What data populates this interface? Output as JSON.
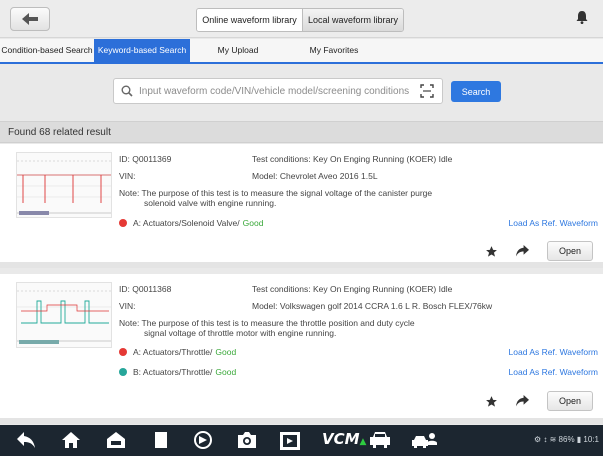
{
  "header": {
    "tabs": [
      "Online waveform library",
      "Local waveform library"
    ]
  },
  "tabs": [
    "Condition-based Search",
    "Keyword-based Search",
    "My Upload",
    "My Favorites"
  ],
  "search": {
    "placeholder": "Input waveform code/VIN/vehicle model/screening conditions",
    "button": "Search"
  },
  "results": {
    "summary": "Found 68 related result",
    "items": [
      {
        "id": "ID: Q0011369",
        "test_conditions": "Test conditions: Key On Enging Running (KOER) Idle",
        "vin": "VIN:",
        "model": "Model: Chevrolet Aveo 2016 1.5L",
        "note_line1": "Note: The purpose of this test is to measure the signal voltage of the canister purge",
        "note_line2": "solenoid valve with engine running.",
        "channels": [
          {
            "label": "A: Actuators/Solenoid Valve/",
            "status": "Good",
            "color": "#e53935",
            "action": "Load As Ref. Waveform"
          }
        ],
        "open": "Open"
      },
      {
        "id": "ID: Q0011368",
        "test_conditions": "Test conditions: Key On Enging Running (KOER) Idle",
        "vin": "VIN:",
        "model": "Model: Volkswagen golf 2014 CCRA 1.6 L R. Bosch FLEX/76kw",
        "note_line1": "Note: The purpose of this test is to measure the throttle position and duty cycle",
        "note_line2": "signal voltage of throttle motor with engine running.",
        "channels": [
          {
            "label": "A: Actuators/Throttle/",
            "status": "Good",
            "color": "#e53935",
            "action": "Load As Ref. Waveform"
          },
          {
            "label": "B: Actuators/Throttle/",
            "status": "Good",
            "color": "#26a69a",
            "action": "Load As Ref. Waveform"
          }
        ],
        "open": "Open"
      }
    ]
  },
  "navbar": {
    "vcm": "VCM",
    "status": "86%"
  },
  "colors": {
    "accent": "#2c6fd9",
    "good": "#3aa83a",
    "navbar": "#1c2630"
  }
}
